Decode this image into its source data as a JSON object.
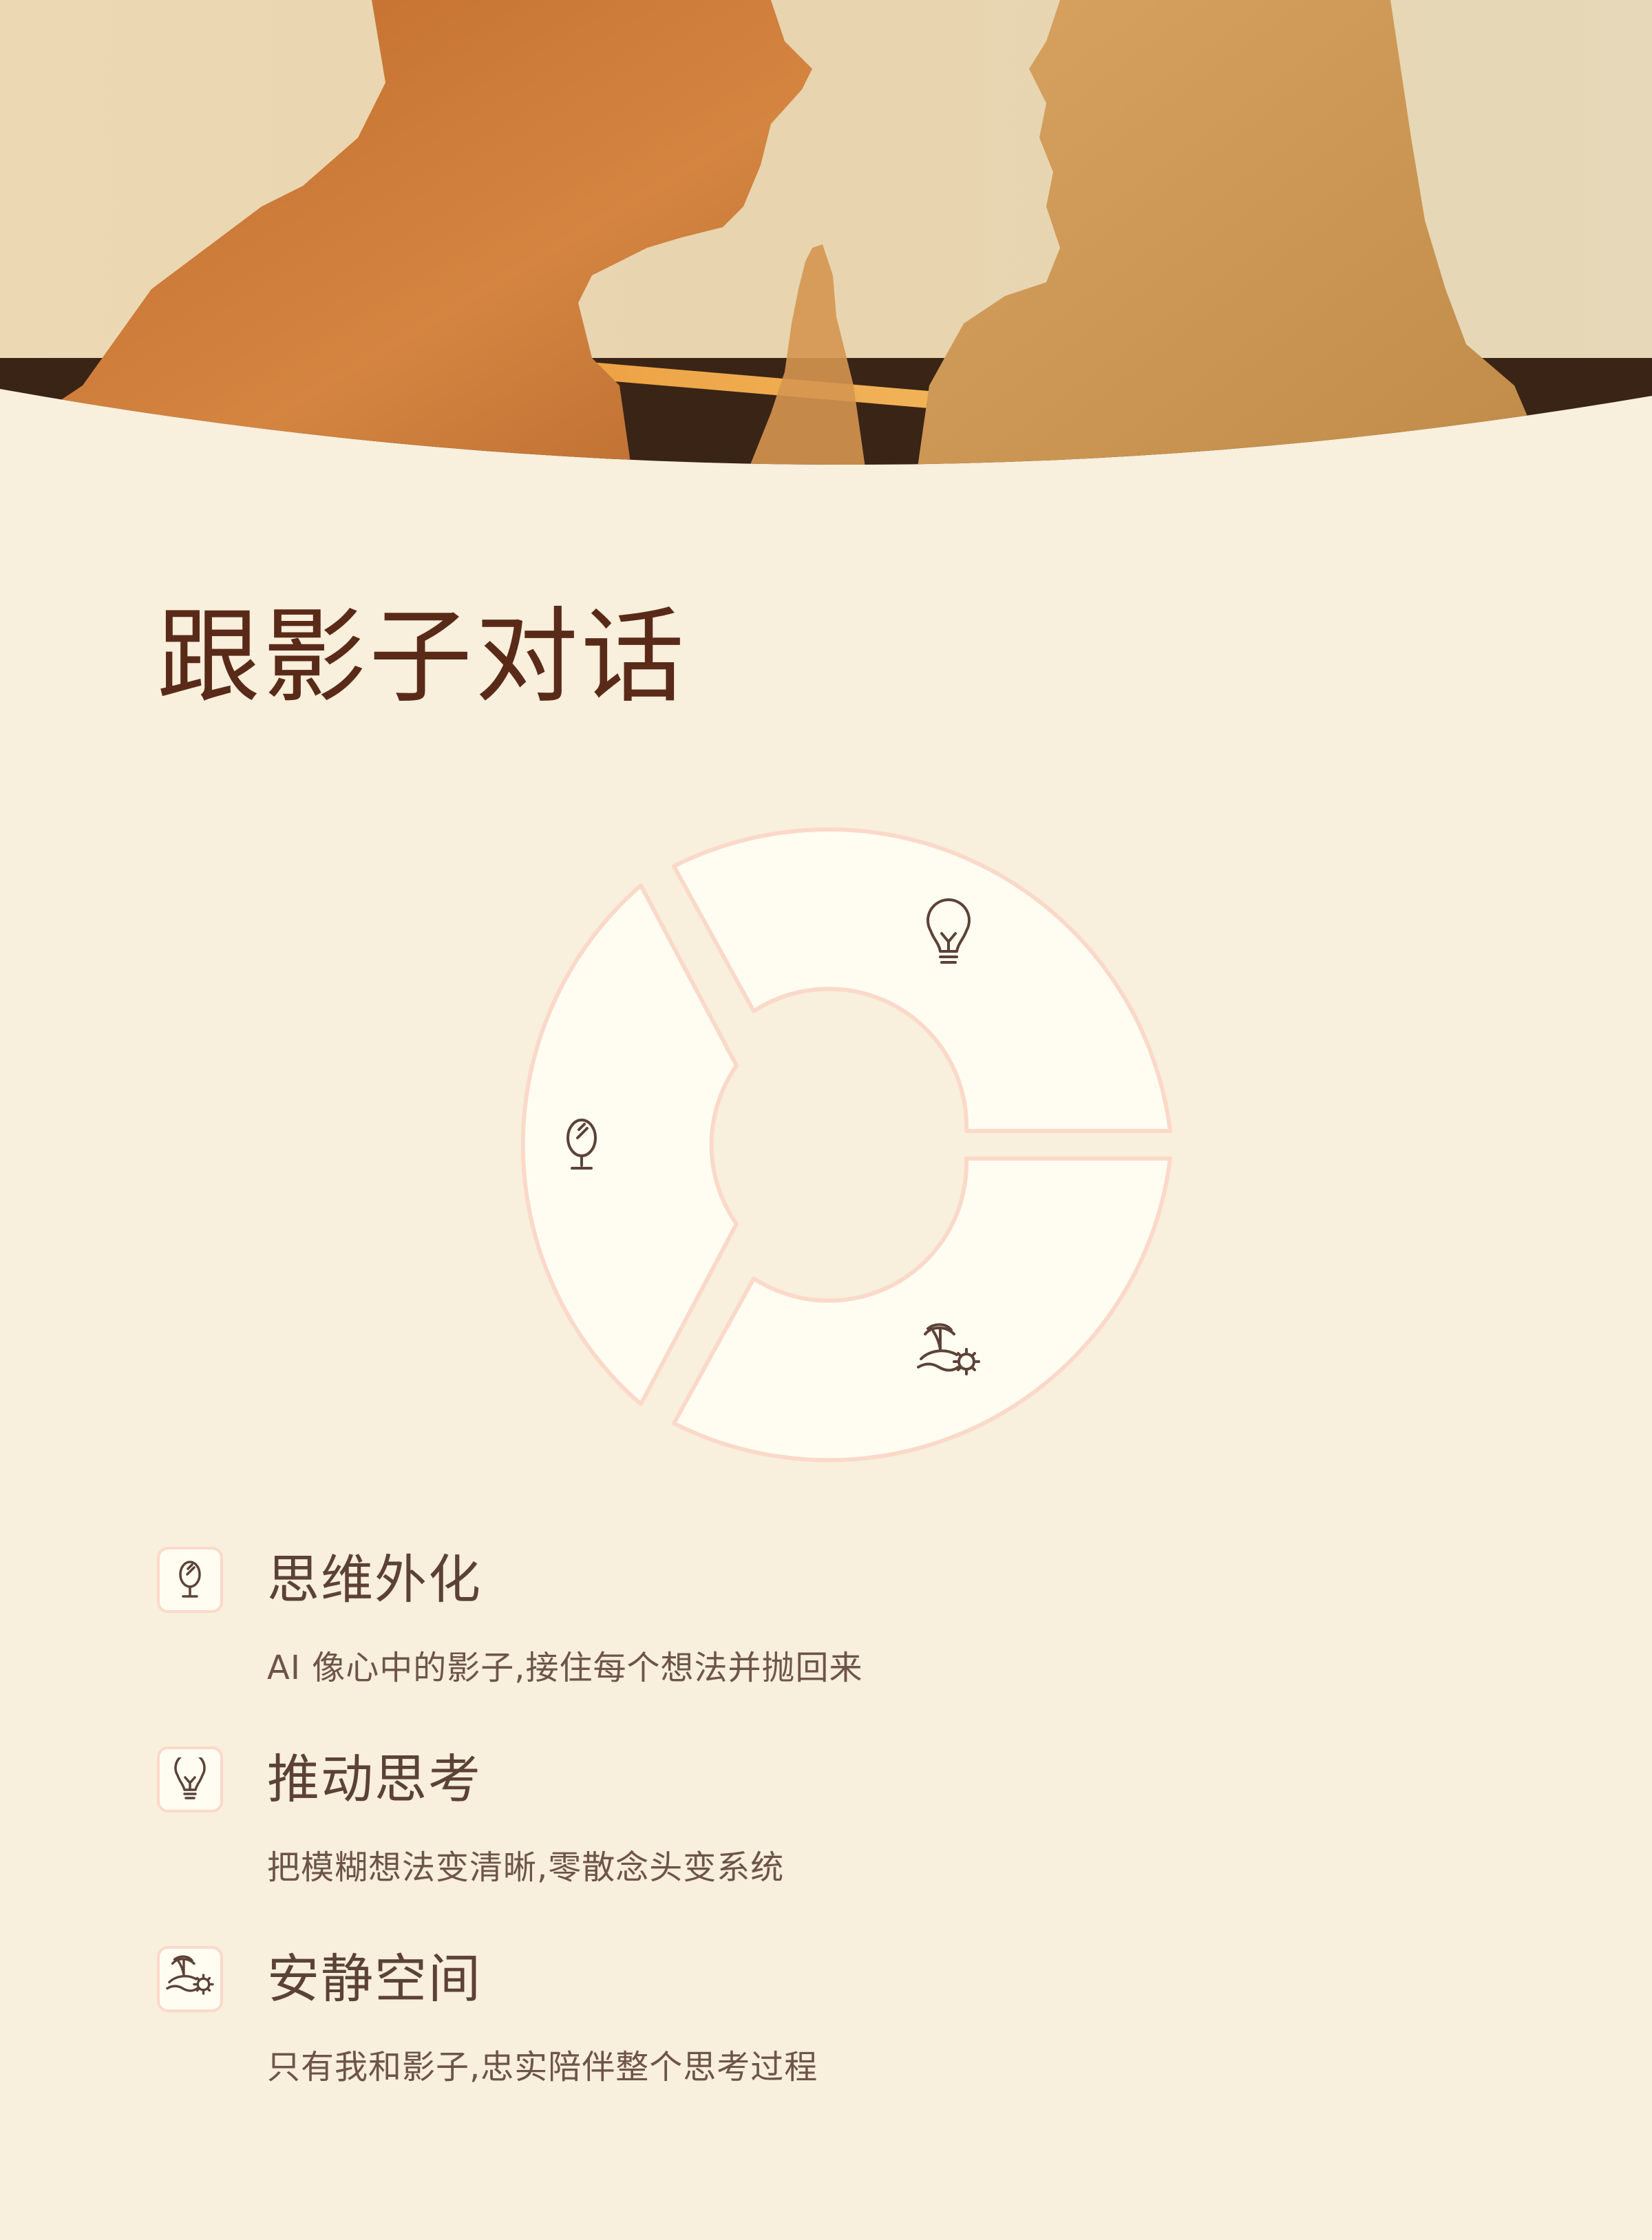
{
  "hero": {
    "image": "silhouettes of a man and a woman facing each other"
  },
  "title": "跟影子对话",
  "ring": {
    "segments": [
      {
        "name": "bulb-icon"
      },
      {
        "name": "island-icon"
      },
      {
        "name": "mirror-icon"
      }
    ]
  },
  "features": [
    {
      "icon": "mirror-icon",
      "title": "思维外化",
      "desc": "AI 像心中的影子,接住每个想法并抛回来"
    },
    {
      "icon": "bulb-icon",
      "title": "推动思考",
      "desc": "把模糊想法变清晰,零散念头变系统"
    },
    {
      "icon": "island-icon",
      "title": "安静空间",
      "desc": "只有我和影子,忠实陪伴整个思考过程"
    }
  ],
  "colors": {
    "background": "#f8efdc",
    "title": "#5a2a18",
    "ring_fill": "#fffdf2",
    "ring_stroke": "#fbd9c9",
    "icon_stroke": "#5c4236"
  }
}
